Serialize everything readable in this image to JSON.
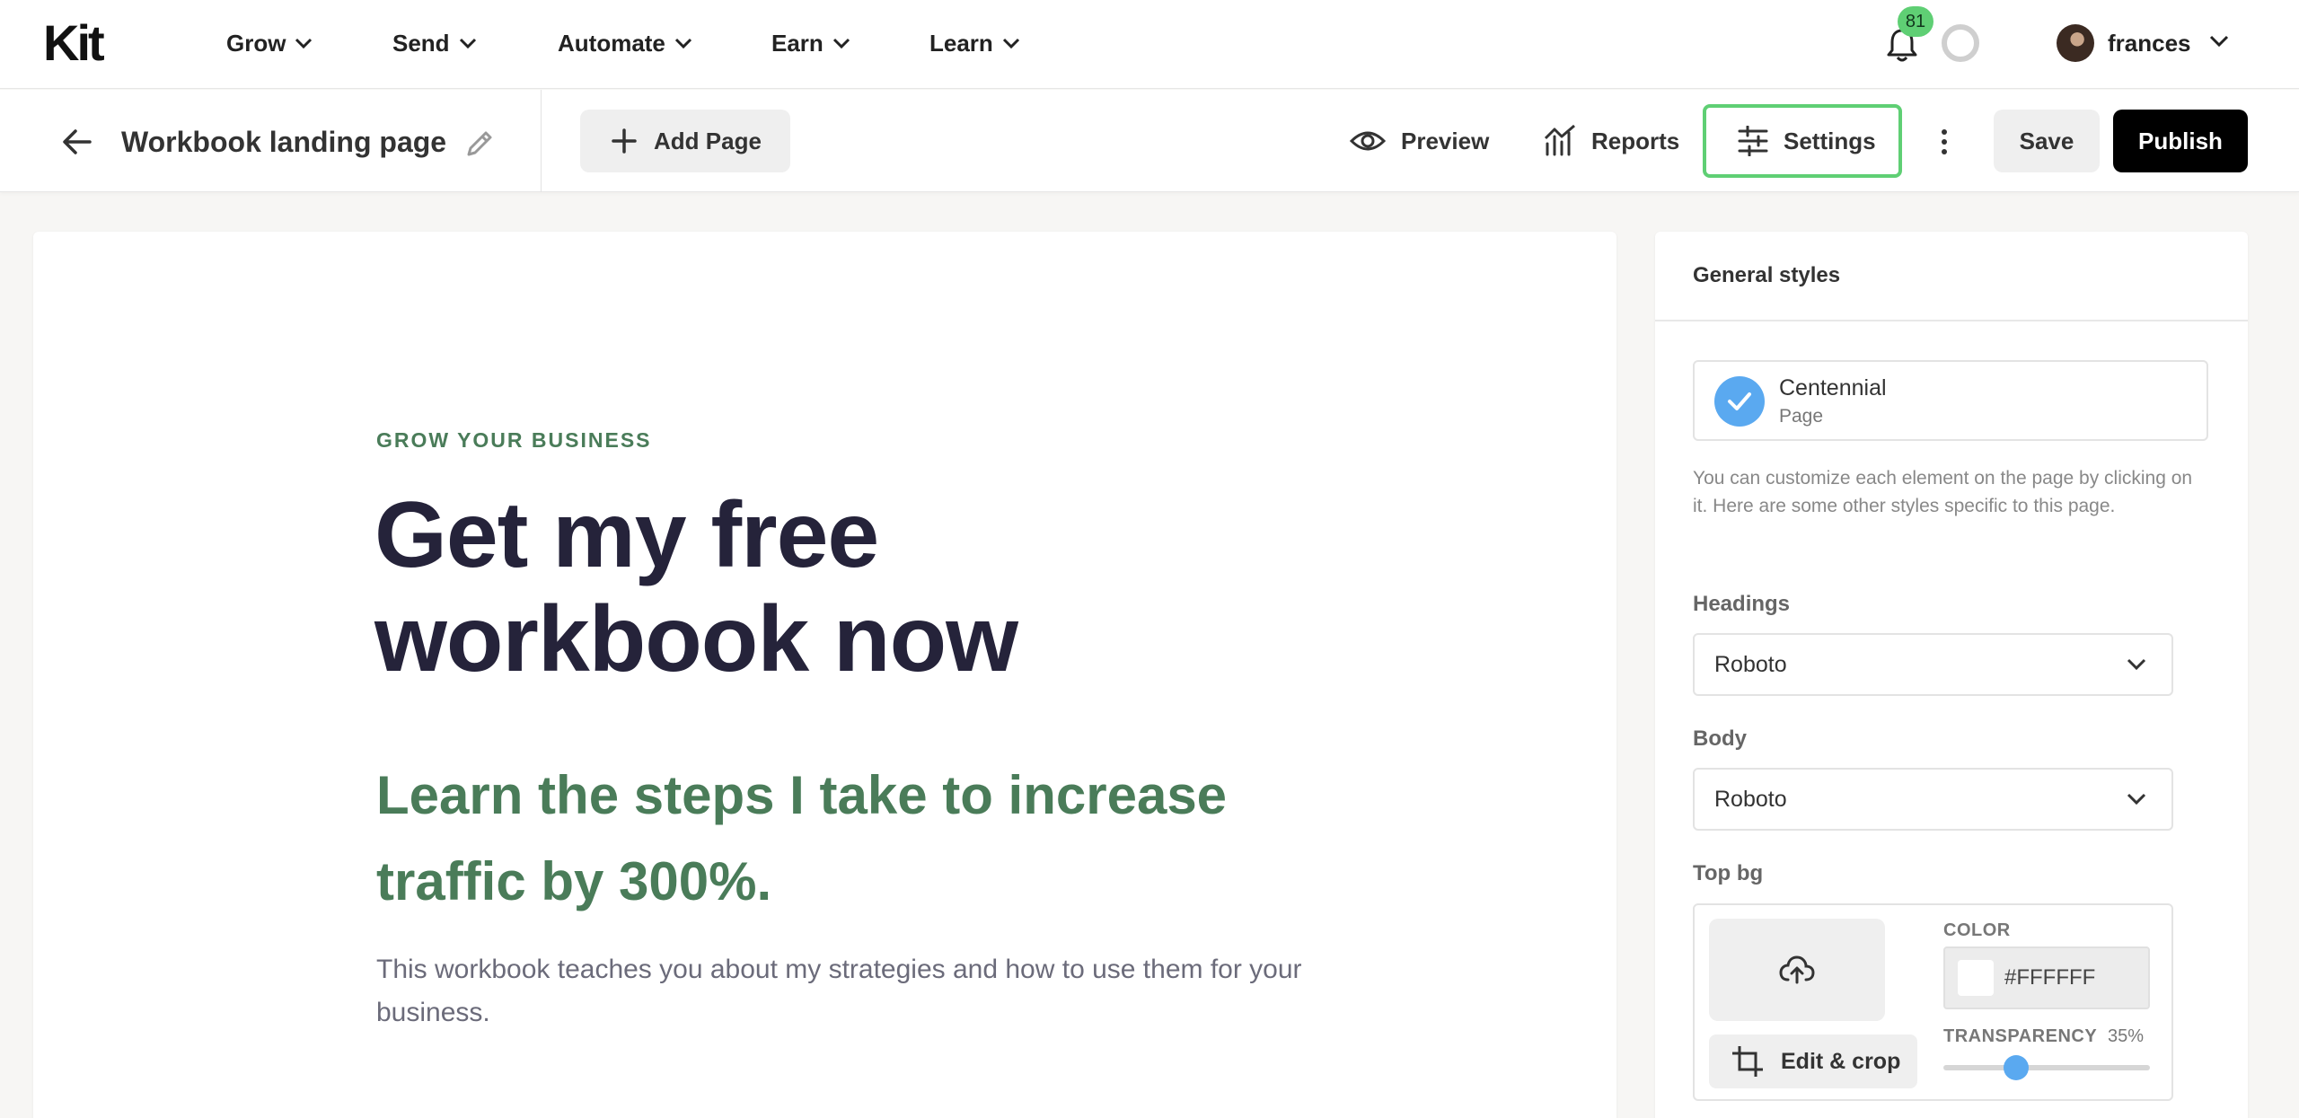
{
  "topnav": {
    "logo": "Kit",
    "items": [
      "Grow",
      "Send",
      "Automate",
      "Earn",
      "Learn"
    ],
    "notification_count": "81",
    "user_name": "frances"
  },
  "editor": {
    "page_title": "Workbook landing page",
    "add_page_label": "Add Page",
    "preview_label": "Preview",
    "reports_label": "Reports",
    "settings_label": "Settings",
    "save_label": "Save",
    "publish_label": "Publish"
  },
  "canvas": {
    "eyebrow": "GROW YOUR BUSINESS",
    "title": "Get my free workbook now",
    "subtitle": "Learn the steps I take to increase traffic by 300%.",
    "body": "This workbook teaches you about my strategies and how to use them for your business."
  },
  "panel": {
    "title": "General styles",
    "template_name": "Centennial",
    "template_type": "Page",
    "help_text": "You can customize each element on the page by clicking on it. Here are some other styles specific to this page.",
    "headings_label": "Headings",
    "headings_value": "Roboto",
    "body_label": "Body",
    "body_value": "Roboto",
    "top_bg_label": "Top bg",
    "edit_crop_label": "Edit & crop",
    "color_label": "COLOR",
    "color_value": "#FFFFFF",
    "transparency_label": "TRANSPARENCY",
    "transparency_value": "35%",
    "transparency_fraction": 0.35
  },
  "colors": {
    "accent_green": "#4a7c59",
    "badge_green": "#5fcf74",
    "accent_blue": "#5aa9f0",
    "heading_dark": "#25233a"
  }
}
